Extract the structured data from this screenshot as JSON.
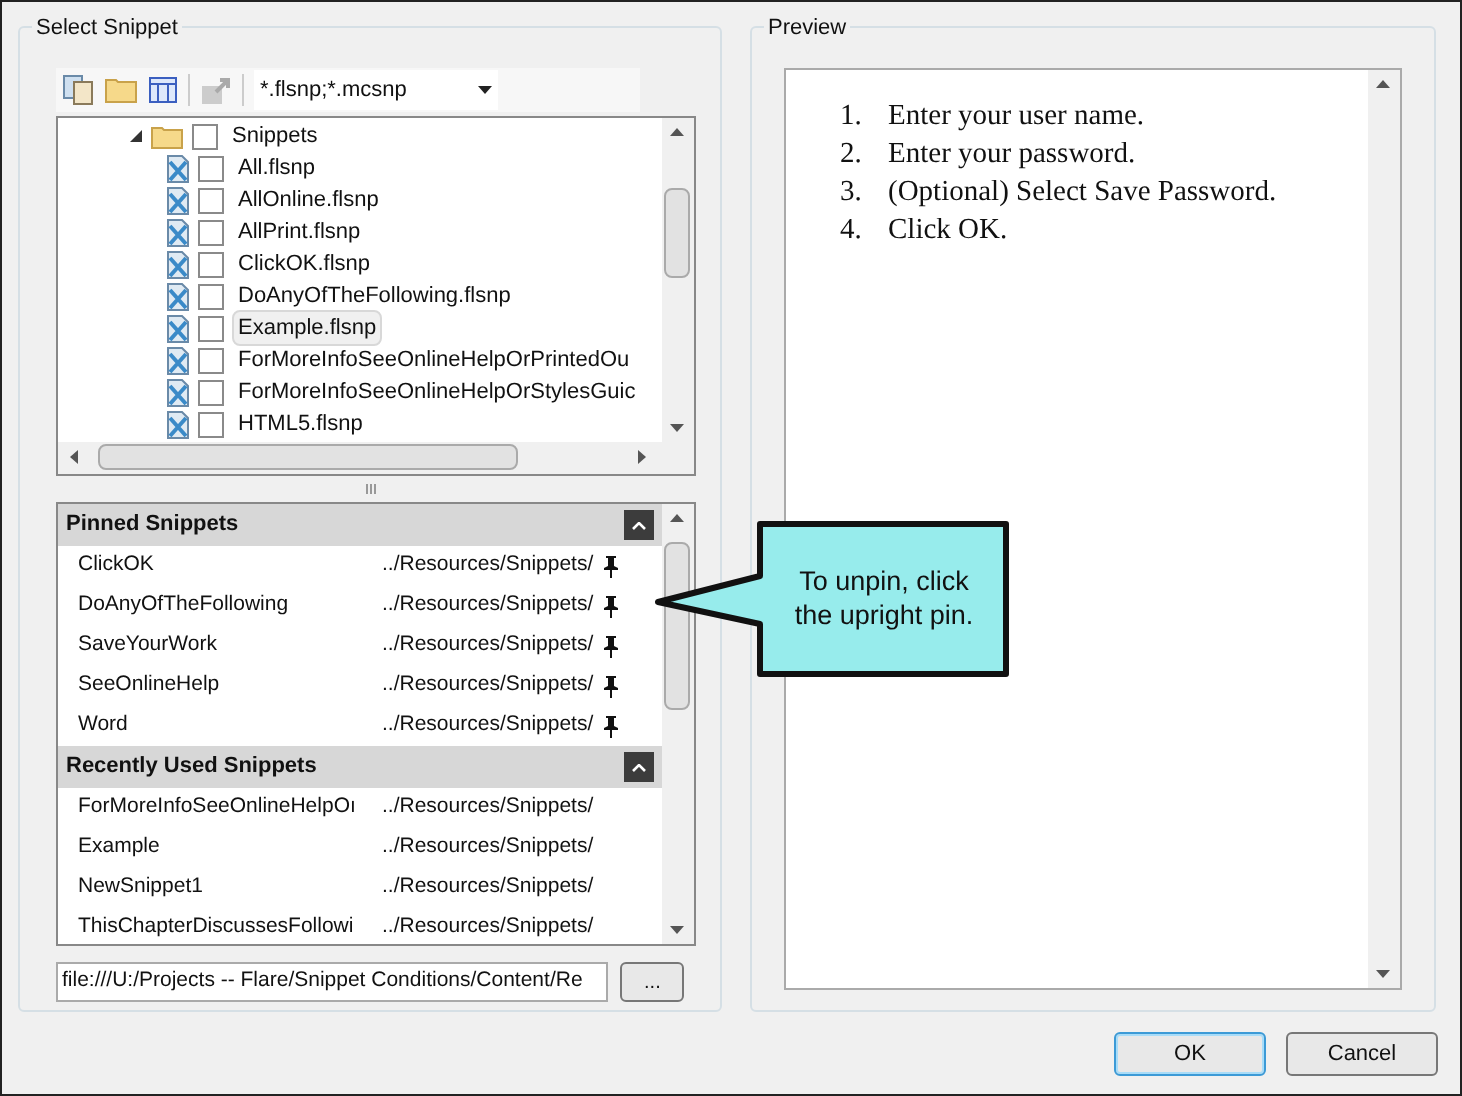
{
  "select_group": {
    "title": "Select Snippet"
  },
  "filter": {
    "value": "*.flsnp;*.mcsnp"
  },
  "tree": [
    {
      "label": "Snippets",
      "kind": "folder",
      "expanded": true,
      "checked": false,
      "selected": false,
      "children": [
        {
          "label": "All.flsnp",
          "kind": "file",
          "checked": false,
          "selected": false
        },
        {
          "label": "AllOnline.flsnp",
          "kind": "file",
          "checked": false,
          "selected": false
        },
        {
          "label": "AllPrint.flsnp",
          "kind": "file",
          "checked": false,
          "selected": false
        },
        {
          "label": "ClickOK.flsnp",
          "kind": "file",
          "checked": false,
          "selected": false
        },
        {
          "label": "DoAnyOfTheFollowing.flsnp",
          "kind": "file",
          "checked": false,
          "selected": false
        },
        {
          "label": "Example.flsnp",
          "kind": "file",
          "checked": false,
          "selected": true
        },
        {
          "label": "ForMoreInfoSeeOnlineHelpOrPrintedOu",
          "kind": "file",
          "checked": false,
          "selected": false
        },
        {
          "label": "ForMoreInfoSeeOnlineHelpOrStylesGuic",
          "kind": "file",
          "checked": false,
          "selected": false
        },
        {
          "label": "HTML5.flsnp",
          "kind": "file",
          "checked": false,
          "selected": false
        }
      ]
    }
  ],
  "sections": [
    {
      "title": "Pinned Snippets",
      "expanded": true,
      "items": [
        {
          "name": "ClickOK",
          "path": "../Resources/Snippets/",
          "pinned": true
        },
        {
          "name": "DoAnyOfTheFollowing",
          "path": "../Resources/Snippets/",
          "pinned": true
        },
        {
          "name": "SaveYourWork",
          "path": "../Resources/Snippets/",
          "pinned": true
        },
        {
          "name": "SeeOnlineHelp",
          "path": "../Resources/Snippets/",
          "pinned": true
        },
        {
          "name": "Word",
          "path": "../Resources/Snippets/",
          "pinned": true
        }
      ]
    },
    {
      "title": "Recently Used Snippets",
      "expanded": true,
      "items": [
        {
          "name": "ForMoreInfoSeeOnlineHelpOı",
          "path": "../Resources/Snippets/",
          "pinned": false
        },
        {
          "name": "Example",
          "path": "../Resources/Snippets/",
          "pinned": false
        },
        {
          "name": "NewSnippet1",
          "path": "../Resources/Snippets/",
          "pinned": false
        },
        {
          "name": "ThisChapterDiscussesFollowi",
          "path": "../Resources/Snippets/",
          "pinned": false
        }
      ]
    }
  ],
  "path_field": {
    "value": "file:///U:/Projects -- Flare/Snippet Conditions/Content/Re"
  },
  "browse_button": "...",
  "callout": "To unpin, click the upright pin.",
  "preview": {
    "title": "Preview",
    "steps": [
      {
        "number": "1.",
        "text": "Enter your user name."
      },
      {
        "number": "2.",
        "text": "Enter your password."
      },
      {
        "number": "3.",
        "text": "(Optional) Select Save Password."
      },
      {
        "number": "4.",
        "text": "Click OK."
      }
    ]
  },
  "buttons": [
    {
      "label": "OK",
      "default": true
    },
    {
      "label": "Cancel",
      "default": false
    }
  ]
}
